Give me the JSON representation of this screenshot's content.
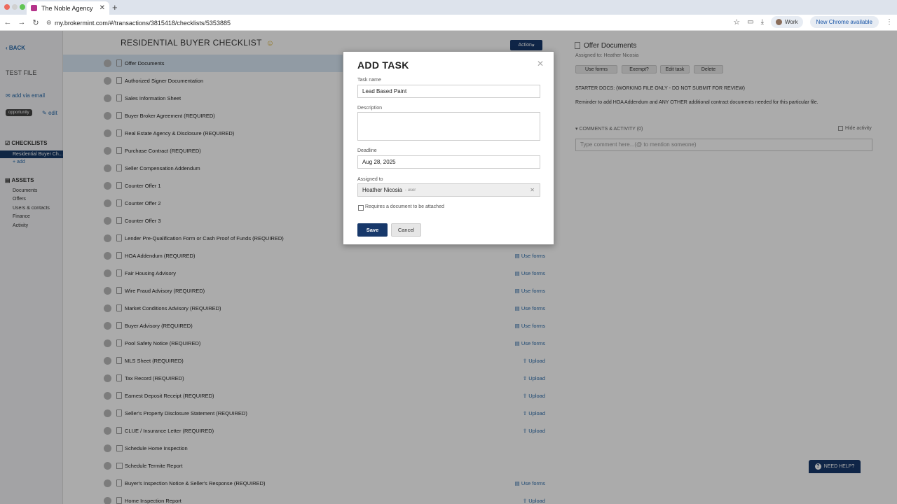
{
  "browser": {
    "tab_title": "The Noble Agency",
    "url": "my.brokermint.com/#/transactions/3815418/checklists/5353885",
    "profile_label": "Work",
    "update_label": "New Chrome available"
  },
  "sidebar": {
    "back_label": "BACK",
    "file_label": "TEST FILE",
    "add_via_email": "add via email",
    "opportunity_badge": "opportunity",
    "edit_label": "edit",
    "checklists_heading": "CHECKLISTS",
    "active_checklist": "Residential Buyer Ch...",
    "add_label": "+ add",
    "assets_heading": "ASSETS",
    "assets": [
      "Documents",
      "Offers",
      "Users & contacts",
      "Finance",
      "Activity"
    ]
  },
  "checklist": {
    "title": "RESIDENTIAL BUYER CHECKLIST",
    "action_label": "Action",
    "tasks": [
      {
        "label": "Offer Documents",
        "action": "",
        "kind": "doc"
      },
      {
        "label": "Authorized Signer Documentation",
        "action": "",
        "kind": "doc"
      },
      {
        "label": "Sales Information Sheet",
        "action": "",
        "kind": "doc"
      },
      {
        "label": "Buyer Broker Agreement (REQUIRED)",
        "action": "",
        "kind": "doc"
      },
      {
        "label": "Real Estate Agency & Disclosure (REQUIRED)",
        "action": "",
        "kind": "doc"
      },
      {
        "label": "Purchase Contract (REQUIRED)",
        "action": "",
        "kind": "doc"
      },
      {
        "label": "Seller Compensation Addendum",
        "action": "",
        "kind": "doc"
      },
      {
        "label": "Counter Offer 1",
        "action": "",
        "kind": "doc"
      },
      {
        "label": "Counter Offer 2",
        "action": "",
        "kind": "doc"
      },
      {
        "label": "Counter Offer 3",
        "action": "",
        "kind": "doc"
      },
      {
        "label": "Lender Pre-Qualification Form or Cash Proof of Funds (REQUIRED)",
        "action": "",
        "kind": "doc"
      },
      {
        "label": "HOA Addendum (REQUIRED)",
        "action": "Use forms",
        "kind": "doc"
      },
      {
        "label": "Fair Housing Advisory",
        "action": "Use forms",
        "kind": "doc"
      },
      {
        "label": "Wire Fraud Advisory (REQUIRED)",
        "action": "Use forms",
        "kind": "doc"
      },
      {
        "label": "Market Conditions Advisory (REQUIRED)",
        "action": "Use forms",
        "kind": "doc"
      },
      {
        "label": "Buyer Advisory (REQUIRED)",
        "action": "Use forms",
        "kind": "doc"
      },
      {
        "label": "Pool Safety Notice (REQUIRED)",
        "action": "Use forms",
        "kind": "doc"
      },
      {
        "label": "MLS Sheet (REQUIRED)",
        "action": "Upload",
        "kind": "doc"
      },
      {
        "label": "Tax Record (REQUIRED)",
        "action": "Upload",
        "kind": "doc"
      },
      {
        "label": "Earnest Deposit Receipt (REQUIRED)",
        "action": "Upload",
        "kind": "doc"
      },
      {
        "label": "Seller's Property Disclosure Statement (REQUIRED)",
        "action": "Upload",
        "kind": "doc"
      },
      {
        "label": "CLUE / Insurance Letter (REQUIRED)",
        "action": "Upload",
        "kind": "doc"
      },
      {
        "label": "Schedule Home Inspection",
        "action": "",
        "kind": "check"
      },
      {
        "label": "Schedule Termite Report",
        "action": "",
        "kind": "check"
      },
      {
        "label": "Buyer's Inspection Notice & Seller's Response (REQUIRED)",
        "action": "Use forms",
        "kind": "doc"
      },
      {
        "label": "Home Inspection Report",
        "action": "Upload",
        "kind": "doc"
      }
    ]
  },
  "detail": {
    "title": "Offer Documents",
    "assigned": "Assigned to: Heather Nicosia",
    "buttons": [
      "Use forms",
      "Exempt?",
      "Edit task",
      "Delete"
    ],
    "note1": "STARTER DOCS: (WORKING FILE ONLY - DO NOT SUBMIT FOR REVIEW)",
    "note2": "Reminder to add HOA Addendum and ANY OTHER additional contract documents needed for this particular file.",
    "comments_label": "COMMENTS & ACTIVITY (0)",
    "hide_activity": "Hide activity",
    "comment_placeholder": "Type comment here...(@ to mention someone)"
  },
  "help_label": "NEED HELP?",
  "modal": {
    "title": "ADD TASK",
    "task_name_label": "Task name",
    "task_name_value": "Lead Based Paint",
    "description_label": "Description",
    "description_value": "",
    "deadline_label": "Deadline",
    "deadline_value": "Aug 28, 2025",
    "assigned_label": "Assigned to",
    "assignee_name": "Heather Nicosia",
    "assignee_role": "- user",
    "requires_doc_label": "Requires a document to be attached",
    "requires_doc_checked": false,
    "save_label": "Save",
    "cancel_label": "Cancel"
  }
}
